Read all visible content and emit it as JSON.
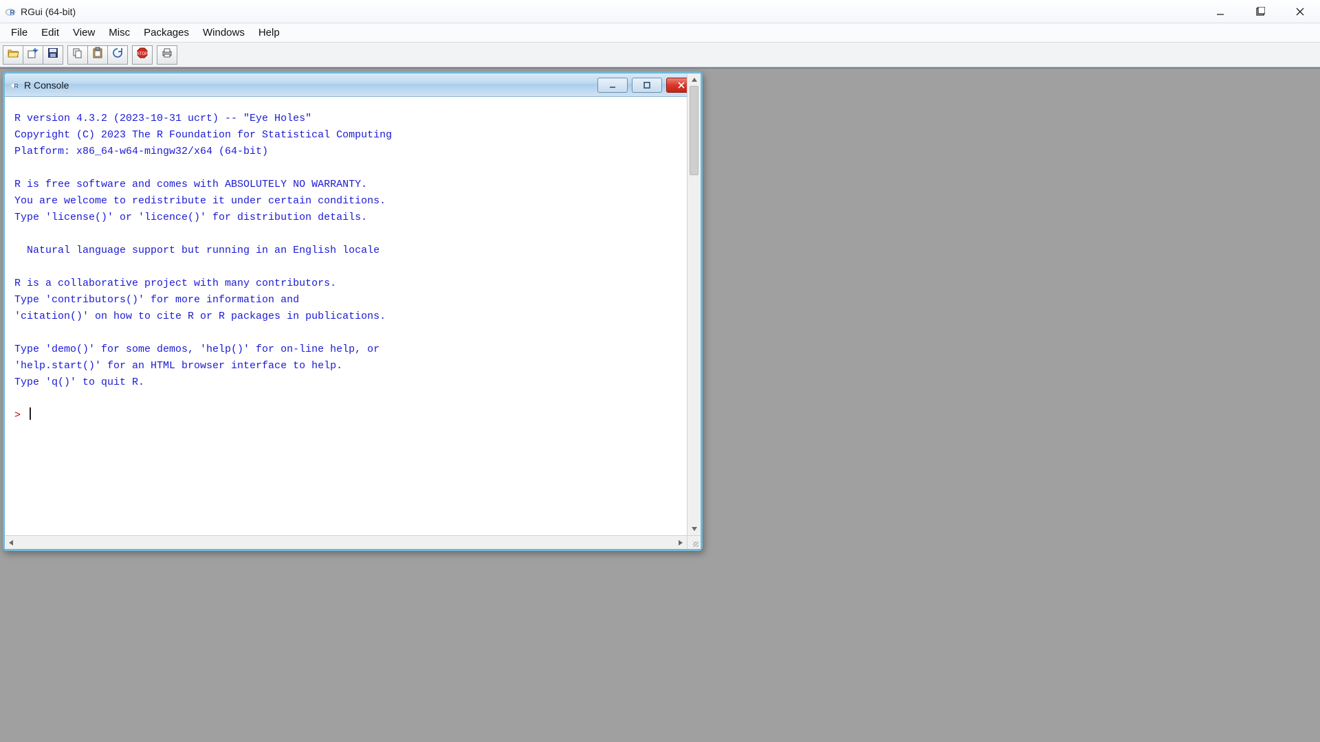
{
  "window": {
    "title": "RGui (64-bit)"
  },
  "menu": {
    "items": [
      "File",
      "Edit",
      "View",
      "Misc",
      "Packages",
      "Windows",
      "Help"
    ]
  },
  "toolbar": {
    "buttons": [
      "open-script",
      "load-workspace",
      "save-workspace",
      "copy",
      "paste",
      "refresh",
      "stop",
      "print"
    ]
  },
  "console": {
    "title": "R Console",
    "lines": [
      "R version 4.3.2 (2023-10-31 ucrt) -- \"Eye Holes\"",
      "Copyright (C) 2023 The R Foundation for Statistical Computing",
      "Platform: x86_64-w64-mingw32/x64 (64-bit)",
      "",
      "R is free software and comes with ABSOLUTELY NO WARRANTY.",
      "You are welcome to redistribute it under certain conditions.",
      "Type 'license()' or 'licence()' for distribution details.",
      "",
      "  Natural language support but running in an English locale",
      "",
      "R is a collaborative project with many contributors.",
      "Type 'contributors()' for more information and",
      "'citation()' on how to cite R or R packages in publications.",
      "",
      "Type 'demo()' for some demos, 'help()' for on-line help, or",
      "'help.start()' for an HTML browser interface to help.",
      "Type 'q()' to quit R.",
      ""
    ],
    "prompt": "> "
  }
}
